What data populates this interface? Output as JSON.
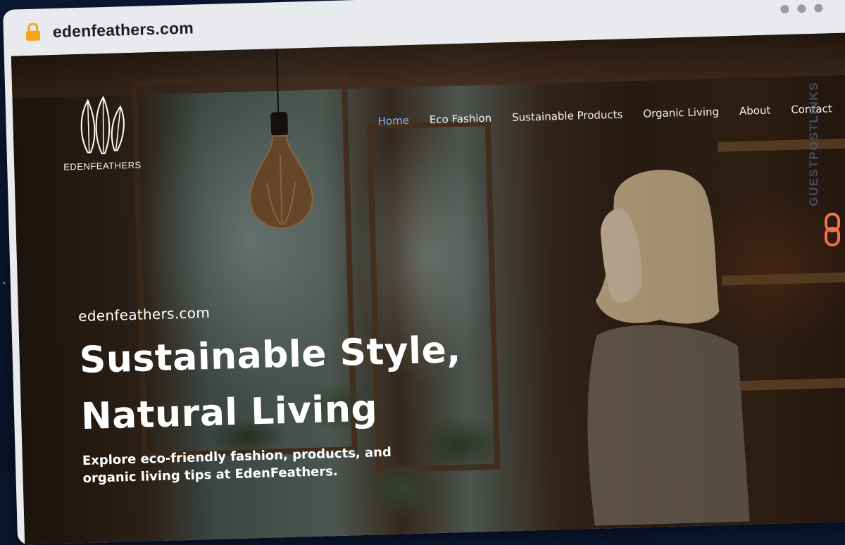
{
  "browser": {
    "url": "edenfeathers.com"
  },
  "logo": {
    "name": "EDENFEATHERS"
  },
  "nav": {
    "items": [
      {
        "label": "Home",
        "active": true
      },
      {
        "label": "Eco Fashion",
        "active": false
      },
      {
        "label": "Sustainable Products",
        "active": false
      },
      {
        "label": "Organic Living",
        "active": false
      },
      {
        "label": "About",
        "active": false
      },
      {
        "label": "Contact",
        "active": false
      }
    ]
  },
  "hero": {
    "domain": "edenfeathers.com",
    "title_line1": "Sustainable Style,",
    "title_line2": "Natural Living",
    "subtitle": "Explore eco-friendly fashion, products, and organic living tips at EdenFeathers."
  },
  "watermark": {
    "text": "GUESTPOSTLINKS"
  },
  "colors": {
    "nav_active": "#7fb8ff",
    "watermark_icon": "#f0714a",
    "lock": "#f3a51b"
  }
}
